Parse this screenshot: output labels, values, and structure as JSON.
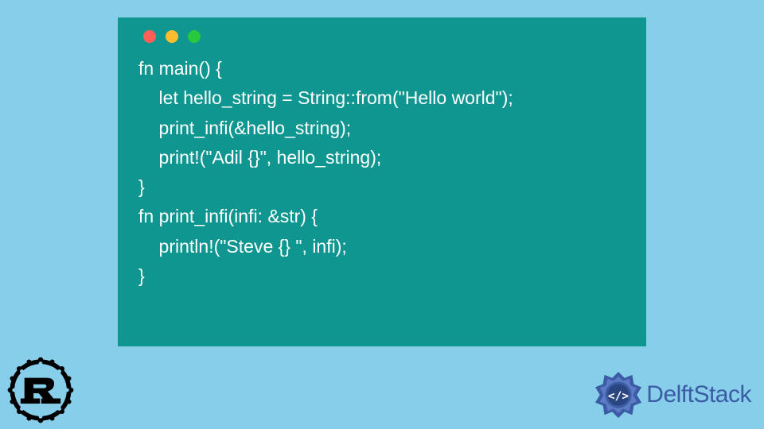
{
  "code": {
    "lines": [
      "fn main() {",
      "    let hello_string = String::from(\"Hello world\");",
      "    print_infi(&hello_string);",
      "    print!(\"Adil {}\", hello_string);",
      "}",
      "fn print_infi(infi: &str) {",
      "    println!(\"Steve {} \", infi);",
      "}"
    ]
  },
  "brand": {
    "name": "DelftStack"
  },
  "traffic": {
    "red": "#FF5F56",
    "yellow": "#FFBD2E",
    "green": "#27C93F"
  },
  "language_icon": "rust-icon"
}
